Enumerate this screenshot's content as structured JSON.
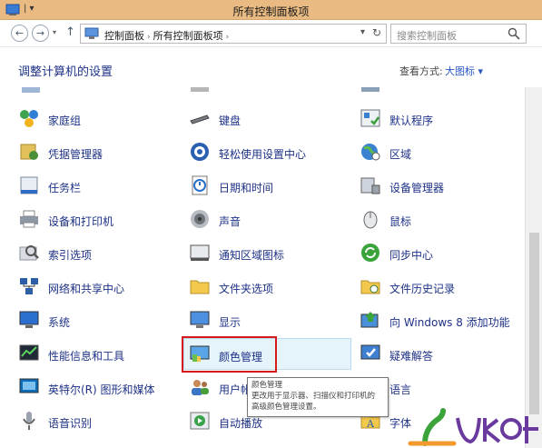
{
  "window": {
    "title": "所有控制面板项"
  },
  "address": {
    "crumbs": [
      "控制面板",
      "所有控制面板项"
    ],
    "search_placeholder": "搜索控制面板"
  },
  "header": {
    "title": "调整计算机的设置",
    "view_label": "查看方式:",
    "view_value": "大图标 ▾"
  },
  "items": {
    "col1": [
      "家庭组",
      "凭据管理器",
      "任务栏",
      "设备和打印机",
      "索引选项",
      "网络和共享中心",
      "系统",
      "性能信息和工具",
      "英特尔(R) 图形和媒体",
      "语音识别"
    ],
    "col2": [
      "键盘",
      "轻松使用设置中心",
      "日期和时间",
      "声音",
      "通知区域图标",
      "文件夹选项",
      "显示",
      "颜色管理",
      "用户帐",
      "自动播放"
    ],
    "col3": [
      "默认程序",
      "区域",
      "设备管理器",
      "鼠标",
      "同步中心",
      "文件历史记录",
      "向 Windows 8 添加功能",
      "疑难解答",
      "语言",
      "字体"
    ]
  },
  "tooltip": {
    "title": "颜色管理",
    "lines": [
      "更改用于显示器、扫描仪和打印机的",
      "高级颜色管理设置。"
    ]
  },
  "colors": {
    "link": "#1e3287",
    "titlebar": "#e9ba82",
    "highlight": "#e5f3fb",
    "redbox": "#d61a1a"
  }
}
